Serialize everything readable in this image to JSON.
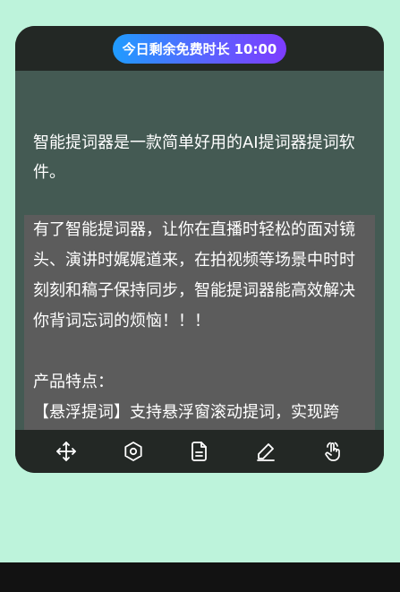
{
  "timer": {
    "label": "今日剩余免费时长",
    "time": "10:00"
  },
  "intro_text": "智能提词器是一款简单好用的AI提词器提词软件。",
  "scroll_content": {
    "paragraph1": "有了智能提词器，让你在直播时轻松的面对镜头、演讲时娓娓道来，在拍视频等场景中时时刻刻和稿子保持同步，智能提词器能高效解决你背词忘词的烦恼！！！",
    "features_title": "产品特点：",
    "feature1": "【悬浮提词】支持悬浮窗滚动提词，实现跨APP"
  },
  "toolbar": {
    "icons": [
      "move-icon",
      "settings-icon",
      "document-icon",
      "edit-icon",
      "touch-icon"
    ]
  },
  "colors": {
    "background": "#bdf3db",
    "window": "#232825",
    "content": "#445a53",
    "panel": "#5c5c5c",
    "accent_start": "#1f9cff",
    "accent_end": "#7d3cff"
  }
}
